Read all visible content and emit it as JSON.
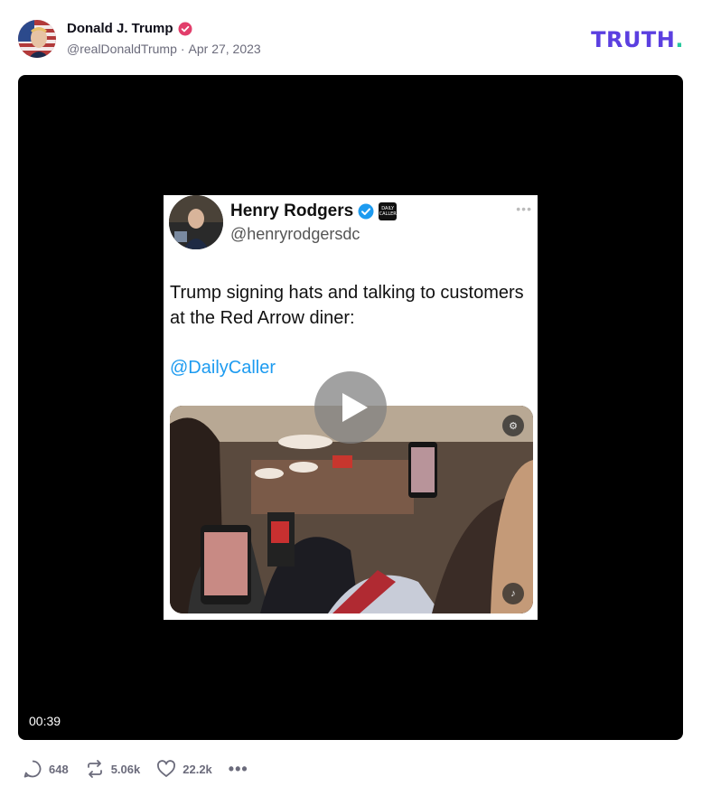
{
  "post": {
    "author": {
      "display_name": "Donald J. Trump",
      "handle": "@realDonaldTrump",
      "separator": "·",
      "date": "Apr 27, 2023",
      "verified": true
    },
    "logo": {
      "text": "TRUTH",
      "dot": "."
    },
    "video": {
      "duration": "00:39",
      "frame": {
        "name": "Henry Rodgers",
        "handle": "@henryrodgersdc",
        "badge_text": "DAILY CALLER",
        "more": "•••",
        "text": "Trump signing hats and talking to customers at the Red Arrow diner:",
        "mention": "@DailyCaller"
      }
    },
    "actions": {
      "replies": "648",
      "retruths": "5.06k",
      "likes": "22.2k"
    }
  },
  "colors": {
    "brand_purple": "#5b3fe0",
    "brand_green": "#27c99e",
    "verified_pink": "#e23e6b",
    "muted": "#6b6b7b"
  },
  "icons": [
    "verified-badge-icon",
    "reply-icon",
    "retruth-icon",
    "heart-icon",
    "more-icon",
    "play-icon"
  ]
}
